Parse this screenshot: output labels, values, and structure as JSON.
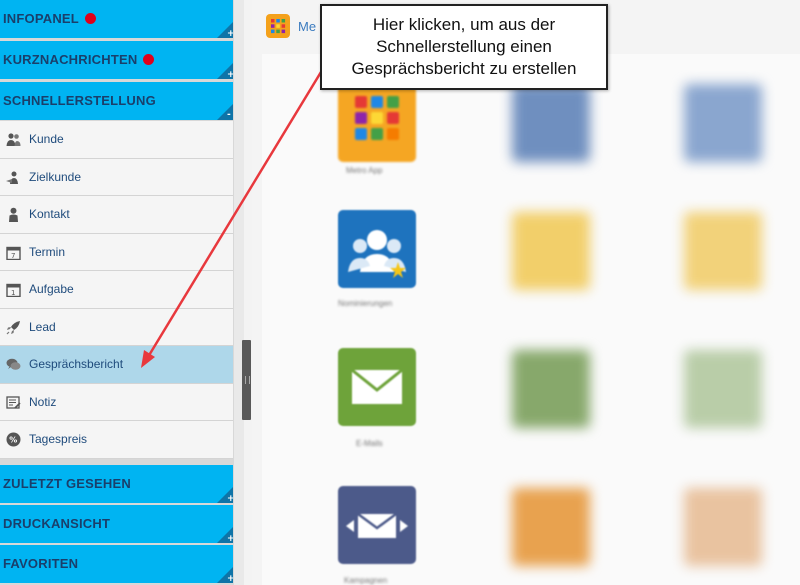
{
  "sidebar": {
    "sections_top": [
      {
        "label": "INFOPANEL",
        "badge": true
      },
      {
        "label": "KURZNACHRICHTEN",
        "badge": true
      },
      {
        "label": "SCHNELLERSTELLUNG",
        "badge": false
      }
    ],
    "items": [
      {
        "label": "Kunde",
        "icon": "customers-icon"
      },
      {
        "label": "Zielkunde",
        "icon": "target-customer-icon"
      },
      {
        "label": "Kontakt",
        "icon": "contact-icon"
      },
      {
        "label": "Termin",
        "icon": "calendar-icon"
      },
      {
        "label": "Aufgabe",
        "icon": "task-icon"
      },
      {
        "label": "Lead",
        "icon": "rocket-icon"
      },
      {
        "label": "Gesprächsbericht",
        "icon": "conversation-icon",
        "active": true
      },
      {
        "label": "Notiz",
        "icon": "note-icon"
      },
      {
        "label": "Tagespreis",
        "icon": "percent-icon"
      }
    ],
    "sections_bottom": [
      {
        "label": "ZULETZT GESEHEN"
      },
      {
        "label": "DRUCKANSICHT"
      },
      {
        "label": "FAVORITEN"
      }
    ]
  },
  "main": {
    "header_title": "Me",
    "tile_labels": [
      "Metro App",
      "Nominierungen",
      "E-Mails",
      "Kampagnen"
    ]
  },
  "callout": {
    "line1": "Hier klicken, um aus der",
    "line2": "Schnellerstellung einen",
    "line3": "Gesprächsbericht zu erstellen"
  },
  "colors": {
    "section_bg": "#00b4f2",
    "badge": "#e0001b",
    "active_item": "#aed7ea",
    "arrow": "#e8383d"
  }
}
